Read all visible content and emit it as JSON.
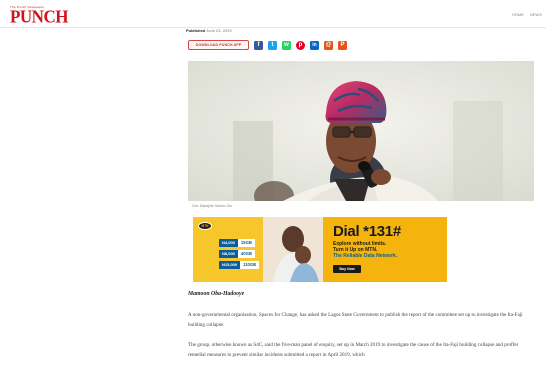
{
  "header": {
    "logo_tag": "The Punch Newspaper",
    "logo_word": "PUNCH",
    "nav": [
      "HOME",
      "NEWS"
    ]
  },
  "article": {
    "published_label": "Published",
    "published_date": "June 23, 2019",
    "download_button": "DOWNLOAD PUNCH APP",
    "share_icons": [
      {
        "name": "facebook",
        "glyph": "f",
        "color": "#3b5998"
      },
      {
        "name": "twitter",
        "glyph": "t",
        "color": "#1da1f2"
      },
      {
        "name": "whatsapp",
        "glyph": "w",
        "color": "#25d366"
      },
      {
        "name": "pinterest",
        "glyph": "p",
        "color": "#e60023"
      },
      {
        "name": "linkedin",
        "glyph": "in",
        "color": "#0a66c2"
      },
      {
        "name": "email",
        "glyph": "@",
        "color": "#d95a1c"
      },
      {
        "name": "print",
        "glyph": "P",
        "color": "#e5511f"
      }
    ],
    "photo_caption": "Gov. Babajide Sanwo-Olu",
    "byline": "Mamoon Oba-Hadooye",
    "paragraphs": [
      "A non-governmental organisation, Spaces for Change, has asked the Lagos State Government to publish the report of the committee set up to investigate the Ita-Faji building collapse.",
      "The group, otherwise known as S4C, said the five-man panel of enquiry, set up in March 2019 to investigate the cause of the Ita-Faji building collapse and proffer remedial measures to prevent similar incidents submitted a report in April 2019, which"
    ]
  },
  "ad": {
    "brand": "MTN",
    "plans": [
      {
        "price": "N4,000",
        "data": "15GB"
      },
      {
        "price": "N8,000",
        "data": "40GB"
      },
      {
        "price": "N15,000",
        "data": "110GB"
      }
    ],
    "title": "Dial *131#",
    "lines": [
      "Explore without limits.",
      "Turn it Up on MTN.",
      "The Reliable Data Network."
    ],
    "button": "Buy Now"
  }
}
